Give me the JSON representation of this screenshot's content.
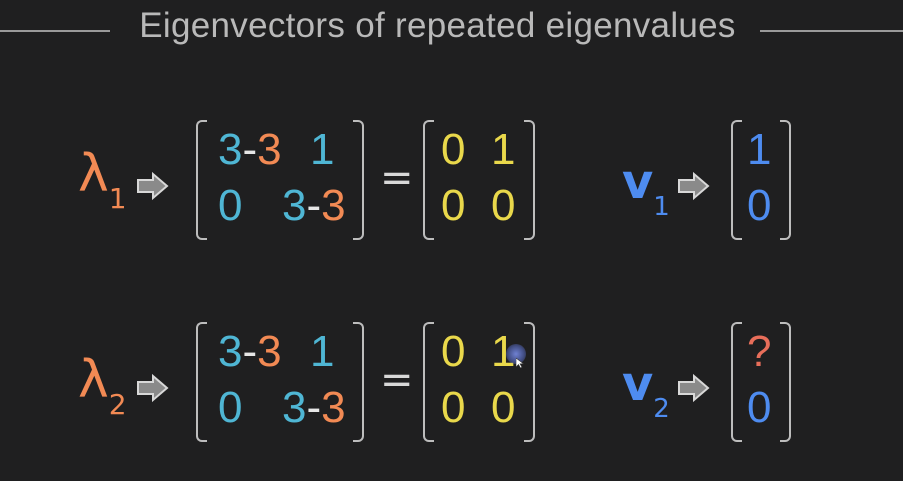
{
  "title": "Eigenvectors of repeated eigenvalues",
  "rows": [
    {
      "lambda": "λ",
      "lambda_sub": "1",
      "left_matrix": {
        "r1c1a": "3",
        "r1c1dash": "-",
        "r1c1b": "3",
        "r1c2": "1",
        "r2c1": "0",
        "r2c2a": "3",
        "r2c2dash": "-",
        "r2c2b": "3"
      },
      "equals": "=",
      "right_matrix": {
        "r1c1": "0",
        "r1c2": "1",
        "r2c1": "0",
        "r2c2": "0"
      },
      "vector_name": "v",
      "vector_sub": "1",
      "vector": {
        "top": "1",
        "bottom": "0"
      }
    },
    {
      "lambda": "λ",
      "lambda_sub": "2",
      "left_matrix": {
        "r1c1a": "3",
        "r1c1dash": "-",
        "r1c1b": "3",
        "r1c2": "1",
        "r2c1": "0",
        "r2c2a": "3",
        "r2c2dash": "-",
        "r2c2b": "3"
      },
      "equals": "=",
      "right_matrix": {
        "r1c1": "0",
        "r1c2": "1",
        "r2c1": "0",
        "r2c2": "0"
      },
      "vector_name": "v",
      "vector_sub": "2",
      "vector": {
        "top": "?",
        "bottom": "0"
      }
    }
  ],
  "icons": {
    "implication_arrow": "right-arrow-icon",
    "cursor": "mouse-cursor-icon"
  },
  "colors": {
    "background": "#1f1f20",
    "lambda": "#f28a54",
    "teal": "#4fb6d4",
    "orange": "#f28a54",
    "yellow": "#e9d84b",
    "vector_blue": "#4e8cf0",
    "question": "#e86e5a"
  }
}
